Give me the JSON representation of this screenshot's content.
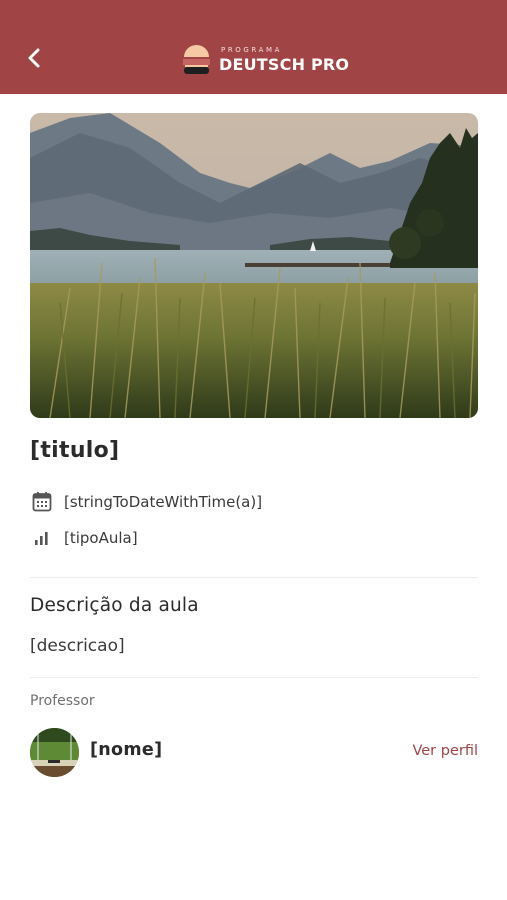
{
  "header": {
    "back_icon": "chevron-left-icon",
    "brand_small": "PROGRAMA",
    "brand_name": "DEUTSCH PRO",
    "colors": {
      "primary": "#a14446",
      "logo_top": "#f4c9a3",
      "logo_mid": "#a14446",
      "logo_bottom": "#1f1f1f"
    }
  },
  "lesson": {
    "image_alt": "landscape photo of lake with mountains and reeds",
    "title": "[titulo]",
    "date_icon": "calendar-icon",
    "date": "[stringToDateWithTime(a)]",
    "type_icon": "signal-bars-icon",
    "type": "[tipoAula]",
    "description_heading": "Descrição da aula",
    "description": "[descricao]"
  },
  "teacher": {
    "label": "Professor",
    "name": "[nome]",
    "profile_link": "Ver perfil"
  }
}
